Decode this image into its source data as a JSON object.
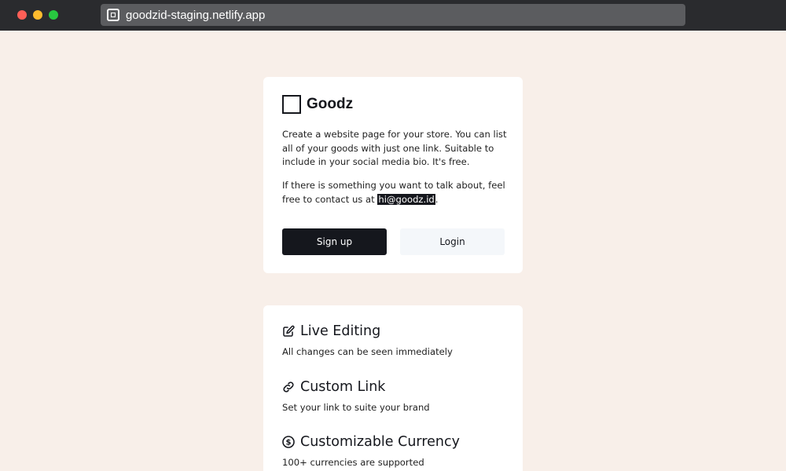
{
  "browser": {
    "url": "goodzid-staging.netlify.app"
  },
  "intro": {
    "brand": "Goodz",
    "description": "Create a website page for your store. You can list all of your goods with just one link. Suitable to include in your social media bio. It's free.",
    "contact_prefix": "If there is something you want to talk about, feel free to contact us at ",
    "contact_email": "hi@goodz.id",
    "contact_suffix": ".",
    "signup_label": "Sign up",
    "login_label": "Login"
  },
  "features": [
    {
      "icon": "edit-icon",
      "title": "Live Editing",
      "description": "All changes can be seen immediately"
    },
    {
      "icon": "link-icon",
      "title": "Custom Link",
      "description": "Set your link to suite your brand"
    },
    {
      "icon": "dollar-icon",
      "title": "Customizable Currency",
      "description": "100+ currencies are supported"
    }
  ]
}
